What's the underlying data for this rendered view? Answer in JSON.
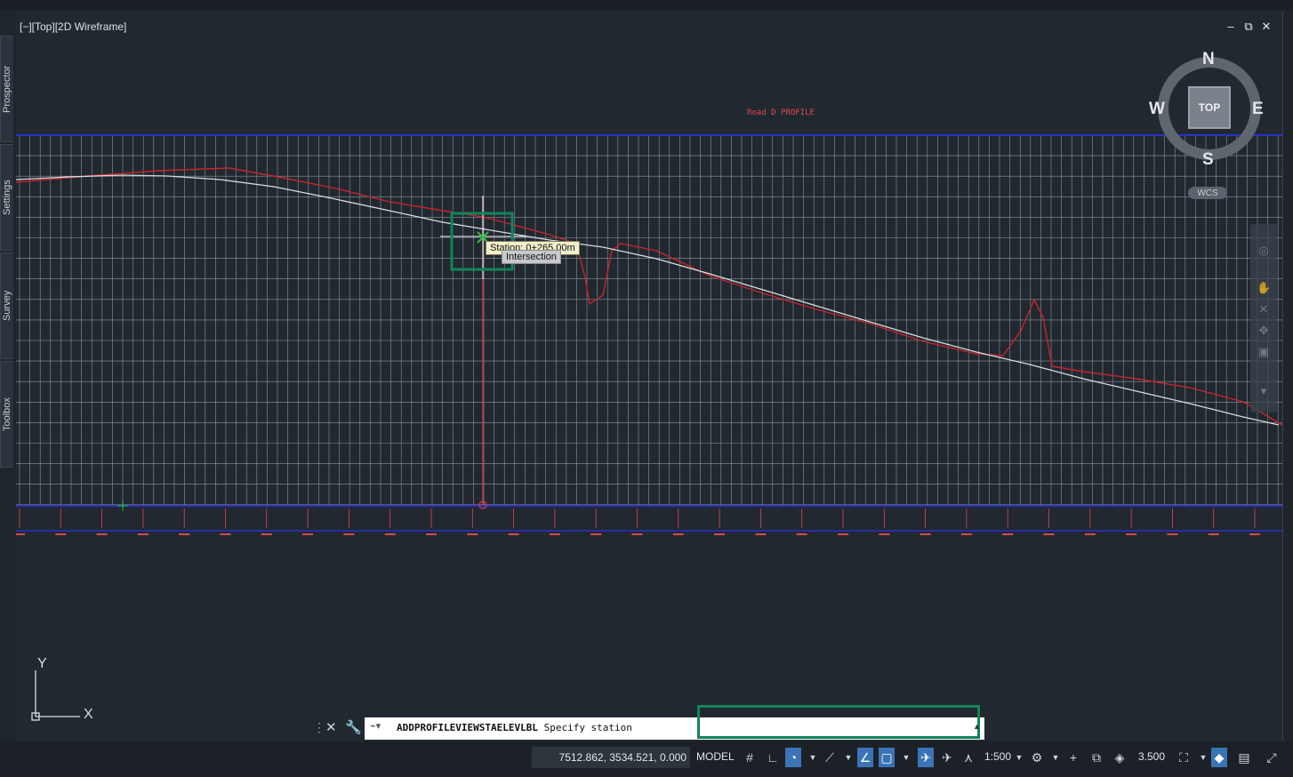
{
  "viewport": {
    "label": "[−][Top][2D Wireframe]",
    "title": "Road D PROFILE",
    "window_controls": {
      "minimize": "–",
      "restore": "⧉",
      "close": "✕"
    }
  },
  "palette_tabs": [
    "Prospector",
    "Settings",
    "Survey",
    "Toolbox"
  ],
  "viewcube": {
    "north": "N",
    "south": "S",
    "east": "E",
    "west": "W",
    "face": "TOP",
    "wcs": "WCS"
  },
  "tooltip": {
    "station": "Station: 0+265.00m",
    "snap": "Intersection"
  },
  "ucs": {
    "x": "X",
    "y": "Y"
  },
  "command_line": {
    "command": "ADDPROFILEVIEWSTAELEVLBL",
    "prompt": "Specify station",
    "value": ""
  },
  "status_bar": {
    "coordinates": "7512.862, 3534.521, 0.000",
    "model": "MODEL",
    "scale": "1:500",
    "annotation_value": "3.500"
  },
  "colors": {
    "profile_line": "#d8dcdf",
    "ground_line": "#c8242c",
    "grid": "#8c95a0",
    "border": "#2831c9",
    "highlight": "#10855a"
  },
  "icons": [
    "grid-icon",
    "snap-icon",
    "ortho-icon",
    "polar-icon",
    "isodraft-icon",
    "osnap-icon",
    "otrack-icon",
    "lineweight-icon",
    "annotation-visibility-icon",
    "autoscale-icon",
    "annotation-scale-icon",
    "gear-icon",
    "plus-icon",
    "isolate-icon",
    "workspace-icon",
    "hardware-accel-icon",
    "clean-screen-icon"
  ]
}
